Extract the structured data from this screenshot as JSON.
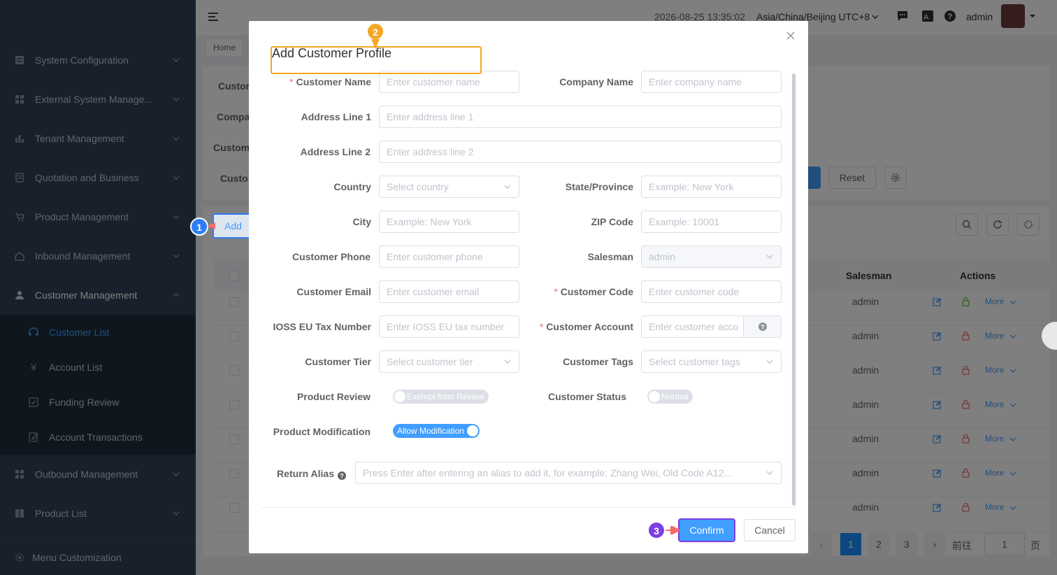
{
  "sidebar": {
    "items": [
      {
        "label": "System Configuration",
        "icon": "server-icon"
      },
      {
        "label": "External System Manage...",
        "icon": "grid-icon"
      },
      {
        "label": "Tenant Management",
        "icon": "bar-chart-icon"
      },
      {
        "label": "Quotation and Business",
        "icon": "document-icon"
      },
      {
        "label": "Product Management",
        "icon": "cart-icon"
      },
      {
        "label": "Inbound Management",
        "icon": "home-icon"
      },
      {
        "label": "Customer Management",
        "icon": "user-icon"
      }
    ],
    "sub_items": [
      {
        "label": "Customer List",
        "icon": "headset-icon",
        "active": true
      },
      {
        "label": "Account List",
        "icon": "yen-icon"
      },
      {
        "label": "Funding Review",
        "icon": "check-square-icon"
      },
      {
        "label": "Account Transactions",
        "icon": "edit-doc-icon"
      }
    ],
    "after_items": [
      {
        "label": "Outbound Management",
        "icon": "grid-icon"
      },
      {
        "label": "Product List",
        "icon": "book-icon"
      }
    ],
    "footer": {
      "label": "Menu Customization",
      "icon": "gear-icon"
    }
  },
  "topbar": {
    "datetime": "2026-08-25 13:35:02",
    "timezone": "Asia/China/Beijing UTC+8",
    "user": "admin"
  },
  "breadcrumb": {
    "home": "Home"
  },
  "background": {
    "filter_labels": [
      "Custor",
      "Compa",
      "Custom",
      "Custo"
    ],
    "reset_label": "Reset",
    "add_label": "Add",
    "table_headers": {
      "salesman": "Salesman",
      "actions": "Actions"
    },
    "rows": [
      {
        "salesman": "admin",
        "more": "More"
      },
      {
        "salesman": "admin",
        "more": "More"
      },
      {
        "salesman": "admin",
        "more": "More"
      },
      {
        "salesman": "admin",
        "more": "More"
      },
      {
        "salesman": "admin",
        "more": "More"
      },
      {
        "salesman": "admin",
        "more": "More"
      },
      {
        "salesman": "admin",
        "more": "More"
      }
    ],
    "pagination": {
      "pages": [
        "1",
        "2",
        "3"
      ],
      "goto_label": "前往",
      "goto_value": "1",
      "page_suffix": "页"
    }
  },
  "dialog": {
    "title": "Add Customer Profile",
    "fields": {
      "customer_name": {
        "label": "Customer Name",
        "placeholder": "Enter customer name"
      },
      "company_name": {
        "label": "Company Name",
        "placeholder": "Enter company name"
      },
      "address1": {
        "label": "Address Line 1",
        "placeholder": "Enter address line 1"
      },
      "address2": {
        "label": "Address Line 2",
        "placeholder": "Enter address line 2"
      },
      "country": {
        "label": "Country",
        "placeholder": "Select country"
      },
      "state": {
        "label": "State/Province",
        "placeholder": "Example: New York"
      },
      "city": {
        "label": "City",
        "placeholder": "Example: New York"
      },
      "zip": {
        "label": "ZIP Code",
        "placeholder": "Example: 10001"
      },
      "phone": {
        "label": "Customer Phone",
        "placeholder": "Enter customer phone"
      },
      "salesman": {
        "label": "Salesman",
        "value": "admin"
      },
      "email": {
        "label": "Customer Email",
        "placeholder": "Enter customer email"
      },
      "code": {
        "label": "Customer Code",
        "placeholder": "Enter customer code"
      },
      "ioss": {
        "label": "IOSS EU Tax Number",
        "placeholder": "Enter IOSS EU tax number"
      },
      "account": {
        "label": "Customer Account",
        "placeholder": "Enter customer acco"
      },
      "tier": {
        "label": "Customer Tier",
        "placeholder": "Select customer tier"
      },
      "tags": {
        "label": "Customer Tags",
        "placeholder": "Select customer tags"
      },
      "product_review": {
        "label": "Product Review",
        "toggle": "Exempt from Review"
      },
      "customer_status": {
        "label": "Customer Status",
        "toggle": "Normal"
      },
      "product_modification": {
        "label": "Product Modification",
        "toggle": "Allow Modification"
      },
      "return_alias": {
        "label": "Return Alias",
        "placeholder": "Press Enter after entering an alias to add it, for example: Zhang Wei, Old Code A12..."
      }
    },
    "confirm_label": "Confirm",
    "cancel_label": "Cancel"
  },
  "annotations": {
    "step1": "1",
    "step2": "2",
    "step3": "3"
  },
  "colors": {
    "sidebar_bg": "#304156",
    "primary": "#409eff",
    "annotation_orange": "#f5a623",
    "annotation_blue": "#2f7cf6",
    "annotation_purple": "#7b3fe4",
    "annotation_pointer": "#f56c6c"
  }
}
